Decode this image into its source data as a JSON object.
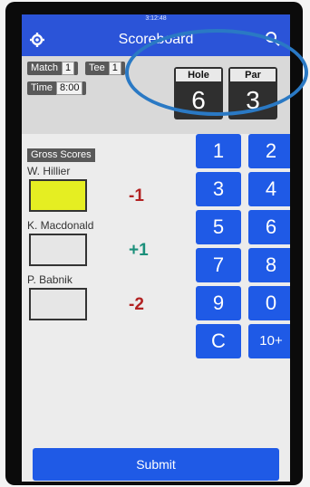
{
  "status_time": "3:12:48",
  "appbar": {
    "title": "Scoreboard",
    "menu_icon": "gear-icon",
    "search_icon": "search-icon"
  },
  "info": {
    "match_label": "Match",
    "match_value": "1",
    "tee_label": "Tee",
    "tee_value": "1",
    "time_label": "Time",
    "time_value": "8:00"
  },
  "hole": {
    "label": "Hole",
    "value": "6"
  },
  "par": {
    "label": "Par",
    "value": "3"
  },
  "gross_scores_label": "Gross Scores",
  "players": [
    {
      "name": "W. Hillier",
      "score": "",
      "diff": "-1"
    },
    {
      "name": "K. Macdonald",
      "score": "",
      "diff": "+1"
    },
    {
      "name": "P. Babnik",
      "score": "",
      "diff": "-2"
    }
  ],
  "keypad": [
    "1",
    "2",
    "3",
    "4",
    "5",
    "6",
    "7",
    "8",
    "9",
    "0",
    "C",
    "10+"
  ],
  "submit_label": "Submit",
  "colors": {
    "primary": "#1f5ae6",
    "appbar": "#2b54d8",
    "active_input": "#e5ee22",
    "under_par": "#b22222",
    "over_par": "#1a8f7a",
    "annotation": "#2a79c4"
  }
}
